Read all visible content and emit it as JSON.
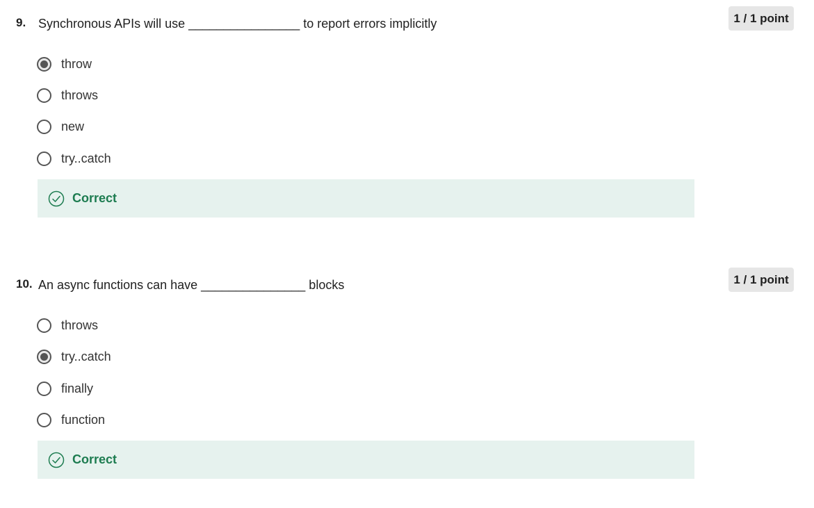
{
  "questions": [
    {
      "number": "9.",
      "text": "Synchronous APIs will use ________________ to report errors implicitly",
      "points": "1 / 1 point",
      "options": [
        {
          "label": "throw",
          "selected": true
        },
        {
          "label": "throws",
          "selected": false
        },
        {
          "label": "new",
          "selected": false
        },
        {
          "label": "try..catch",
          "selected": false
        }
      ],
      "feedback": {
        "label": "Correct",
        "icon": "check-circle-icon",
        "color": "#1d7c50"
      }
    },
    {
      "number": "10.",
      "text": "An async functions can have _______________ blocks",
      "points": "1 / 1 point",
      "options": [
        {
          "label": "throws",
          "selected": false
        },
        {
          "label": "try..catch",
          "selected": true
        },
        {
          "label": "finally",
          "selected": false
        },
        {
          "label": "function",
          "selected": false
        }
      ],
      "feedback": {
        "label": "Correct",
        "icon": "check-circle-icon",
        "color": "#1d7c50"
      }
    }
  ],
  "colors": {
    "feedback_bg": "#e6f2ee",
    "correct_text": "#1d7c50",
    "radio_border": "#555555",
    "points_badge_bg": "#e6e6e6"
  }
}
